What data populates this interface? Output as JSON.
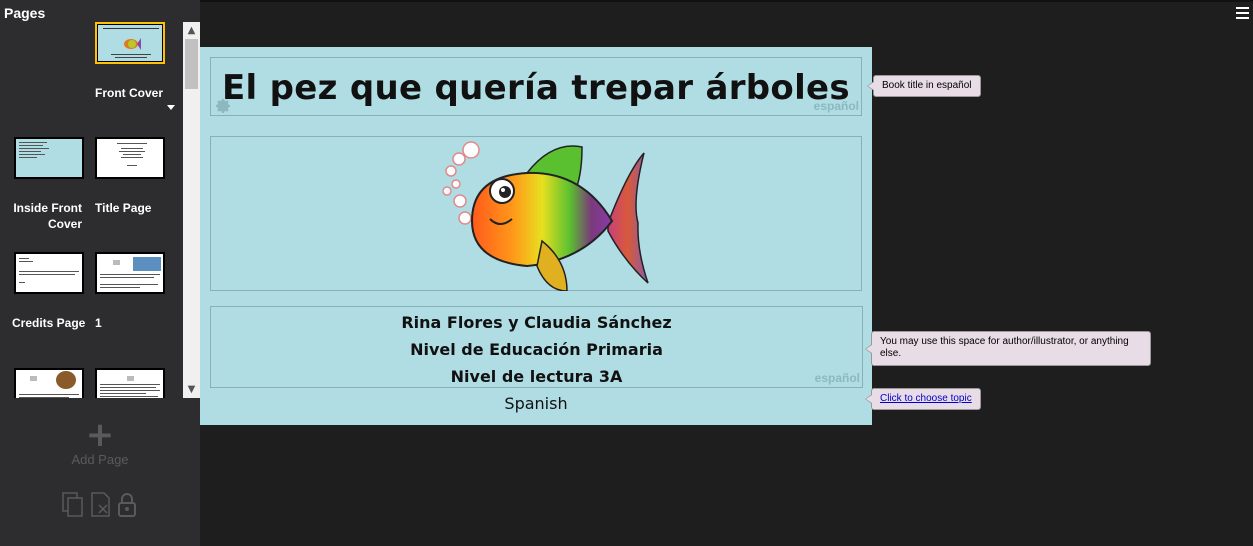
{
  "sidebar": {
    "title": "Pages",
    "pages": [
      {
        "label": "Front Cover"
      },
      {
        "label": "Inside Front Cover"
      },
      {
        "label": "Title Page"
      },
      {
        "label": "Credits Page"
      },
      {
        "label": "1"
      }
    ],
    "add_page_label": "Add Page",
    "add_page_icon": "plus-icon"
  },
  "book": {
    "title": "El pez que quería trepar árboles",
    "title_language": "español",
    "author_lines": [
      "Rina Flores y Claudia Sánchez",
      "Nivel de Educación Primaria",
      "Nivel de lectura 3A"
    ],
    "author_language": "español",
    "topic": "Spanish"
  },
  "tooltips": {
    "title": "Book title in español",
    "author": "You may use this space for author/illustrator, or anything else.",
    "topic": "Click to choose topic"
  },
  "colors": {
    "page_background": "#b0dde4",
    "selected_thumb_border": "#ffc107",
    "app_background": "#1e1e1e",
    "sidebar_background": "#2d2d30"
  }
}
